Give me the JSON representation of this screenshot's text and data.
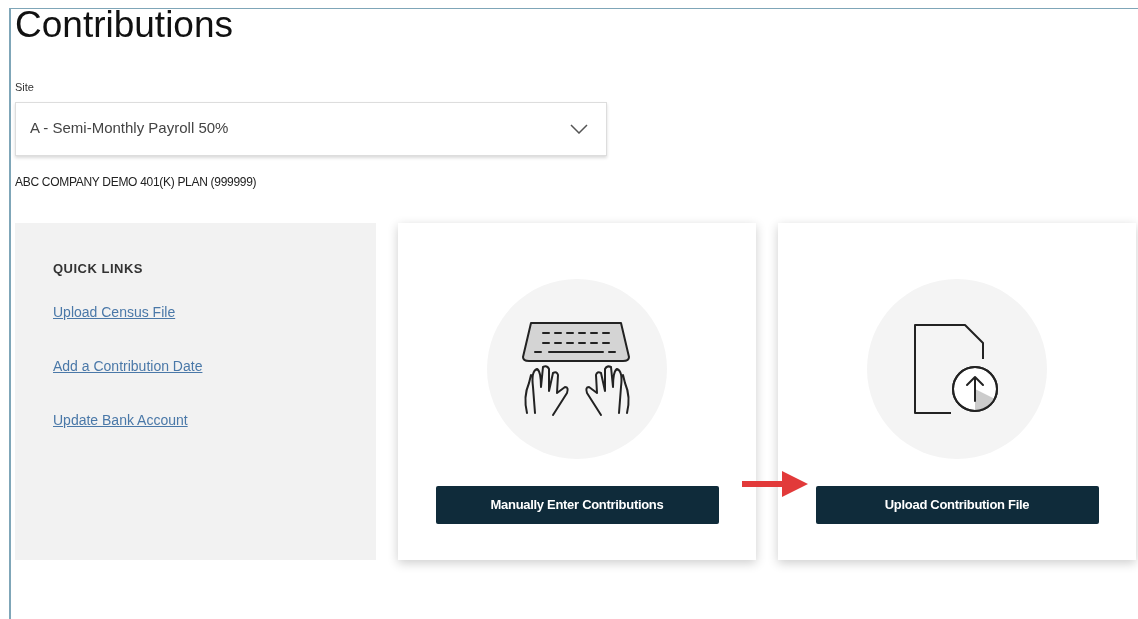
{
  "page": {
    "title": "Contributions"
  },
  "site_select": {
    "label": "Site",
    "value": "A - Semi-Monthly Payroll 50%"
  },
  "plan_name": "ABC COMPANY DEMO 401(K) PLAN (999999)",
  "quick_links": {
    "heading": "QUICK LINKS",
    "links": [
      "Upload Census File",
      "Add a Contribution Date",
      "Update Bank Account"
    ]
  },
  "cards": [
    {
      "kind": "keyboard",
      "button": "Manually Enter Contributions",
      "arrow_pointing": false
    },
    {
      "kind": "upload",
      "button": "Upload Contribution File",
      "arrow_pointing": true
    }
  ]
}
